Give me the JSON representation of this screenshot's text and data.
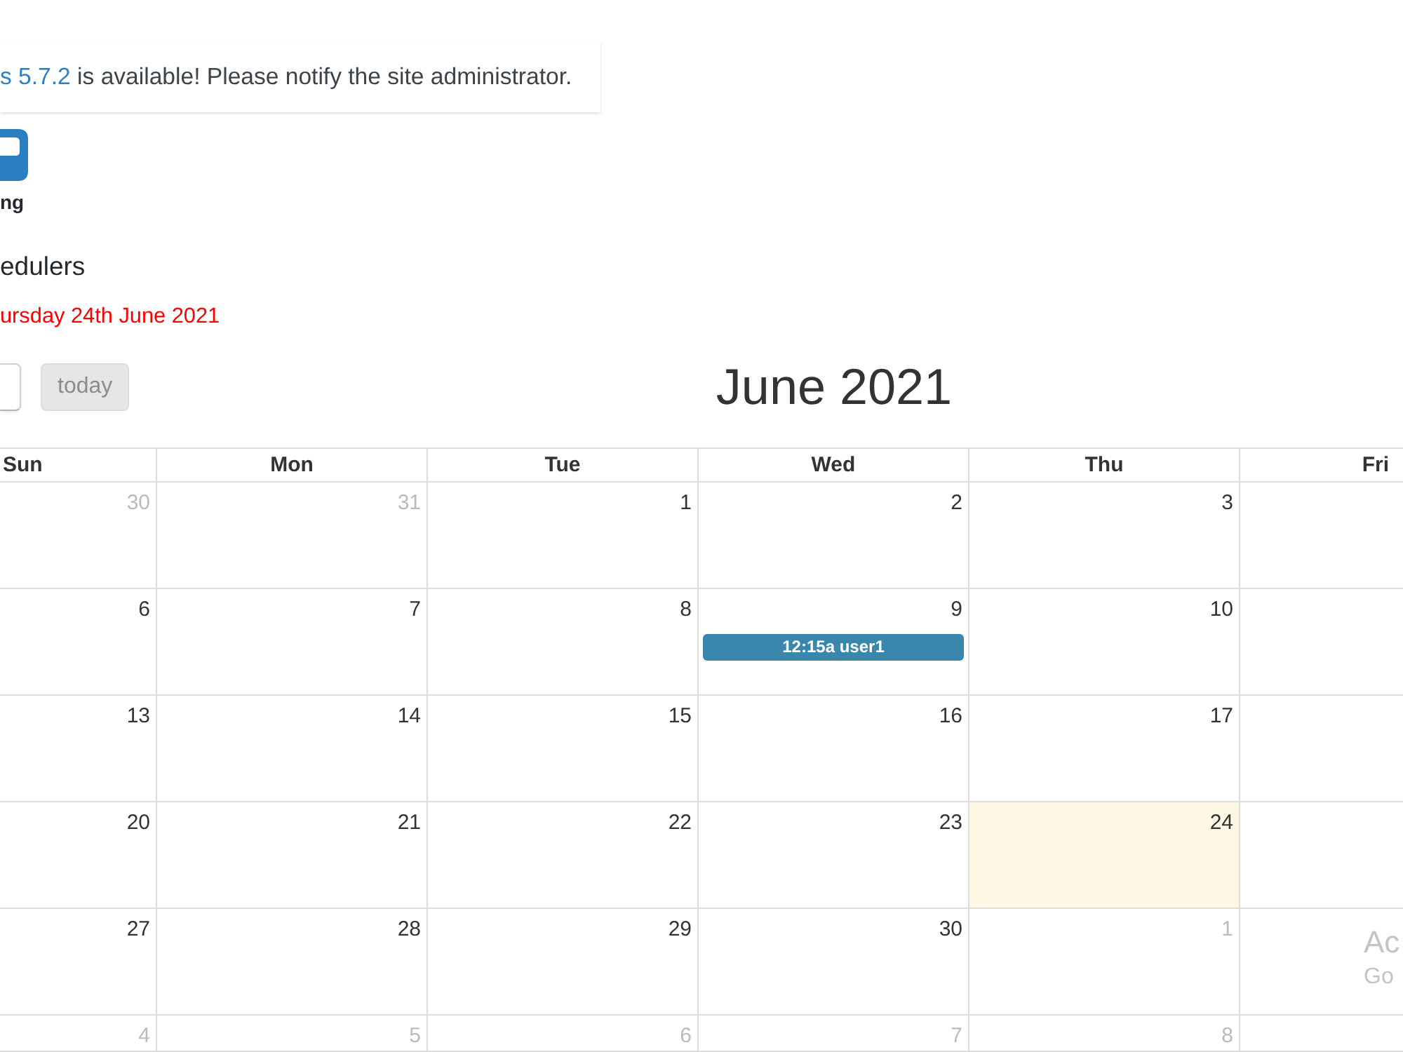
{
  "notice": {
    "link": "s 5.7.2",
    "text": "is available! Please notify the site administrator."
  },
  "logo": {
    "caption": "ng"
  },
  "page": {
    "heading": "edulers",
    "date": "ursday 24th June 2021"
  },
  "toolbar": {
    "buttons": [
      {
        "kind": "nav",
        "disabled": false
      },
      {
        "kind": "today",
        "label": "today",
        "disabled": true
      }
    ]
  },
  "calendar": {
    "title": "June 2021",
    "columns": [
      "Sun",
      "Mon",
      "Tue",
      "Wed",
      "Thu",
      "Fri"
    ],
    "weeks": [
      {
        "days": [
          {
            "day": "30",
            "other_month": true,
            "today": false
          },
          {
            "day": "31",
            "other_month": true,
            "today": false
          },
          {
            "day": "1",
            "other_month": false,
            "today": false
          },
          {
            "day": "2",
            "other_month": false,
            "today": false
          },
          {
            "day": "3",
            "other_month": false,
            "today": false
          },
          {
            "today": false
          }
        ]
      },
      {
        "days": [
          {
            "day": "6",
            "other_month": false,
            "today": false
          },
          {
            "day": "7",
            "other_month": false,
            "today": false
          },
          {
            "day": "8",
            "other_month": false,
            "today": false
          },
          {
            "day": "9",
            "other_month": false,
            "today": false,
            "events": [
              {
                "time": "12:15a",
                "title": "user1"
              }
            ]
          },
          {
            "day": "10",
            "other_month": false,
            "today": false
          },
          {
            "today": false
          }
        ]
      },
      {
        "days": [
          {
            "day": "13",
            "other_month": false,
            "today": false
          },
          {
            "day": "14",
            "other_month": false,
            "today": false
          },
          {
            "day": "15",
            "other_month": false,
            "today": false
          },
          {
            "day": "16",
            "other_month": false,
            "today": false
          },
          {
            "day": "17",
            "other_month": false,
            "today": false
          },
          {
            "today": false
          }
        ]
      },
      {
        "days": [
          {
            "day": "20",
            "other_month": false,
            "today": false
          },
          {
            "day": "21",
            "other_month": false,
            "today": false
          },
          {
            "day": "22",
            "other_month": false,
            "today": false
          },
          {
            "day": "23",
            "other_month": false,
            "today": false
          },
          {
            "day": "24",
            "other_month": false,
            "today": true
          },
          {
            "today": false
          }
        ]
      },
      {
        "days": [
          {
            "day": "27",
            "other_month": false,
            "today": false
          },
          {
            "day": "28",
            "other_month": false,
            "today": false
          },
          {
            "day": "29",
            "other_month": false,
            "today": false
          },
          {
            "day": "30",
            "other_month": false,
            "today": false
          },
          {
            "day": "1",
            "other_month": true,
            "today": false
          },
          {
            "today": false
          }
        ]
      },
      {
        "days": [
          {
            "day": "4",
            "other_month": true,
            "today": false
          },
          {
            "day": "5",
            "other_month": true,
            "today": false
          },
          {
            "day": "6",
            "other_month": true,
            "today": false
          },
          {
            "day": "7",
            "other_month": true,
            "today": false
          },
          {
            "day": "8",
            "other_month": true,
            "today": false
          },
          {
            "today": false
          }
        ]
      }
    ]
  },
  "system_overlay": {
    "lines": [
      "Ac",
      "Go"
    ]
  }
}
